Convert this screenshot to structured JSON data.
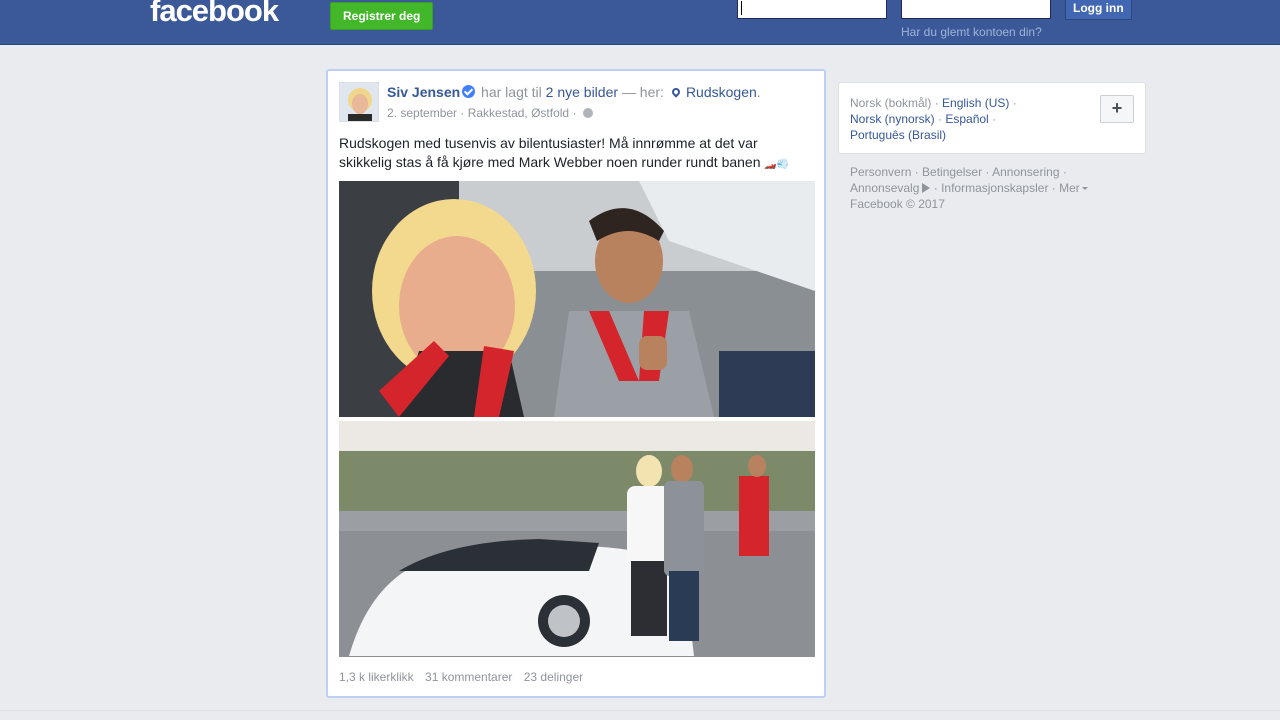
{
  "topbar": {
    "logo": "facebook",
    "register_label": "Registrer deg",
    "login_label": "Logg inn",
    "forgot_label": "Har du glemt kontoen din?"
  },
  "post": {
    "author": "Siv Jensen",
    "action_text": "har lagt til",
    "photos_link": "2 nye bilder",
    "location_prefix": "— her:",
    "location": "Rudskogen",
    "date": "2. september",
    "place": "Rakkestad, Østfold",
    "text": "Rudskogen med tusenvis av bilentusiaster! Må innrømme at det var skikkelig stas å få kjøre med Mark Webber noen runder rundt banen",
    "likes": "1,3 k likerklikk",
    "comments": "31 kommentarer",
    "shares": "23 delinger"
  },
  "languages": {
    "current": "Norsk (bokmål)",
    "english": "English (US)",
    "nynorsk": "Norsk (nynorsk)",
    "spanish": "Español",
    "portuguese": "Português (Brasil)"
  },
  "footer": {
    "privacy": "Personvern",
    "terms": "Betingelser",
    "advertising": "Annonsering",
    "ad_choices": "Annonsevalg",
    "cookies": "Informasjonskapsler",
    "more": "Mer",
    "copyright": "Facebook © 2017"
  }
}
